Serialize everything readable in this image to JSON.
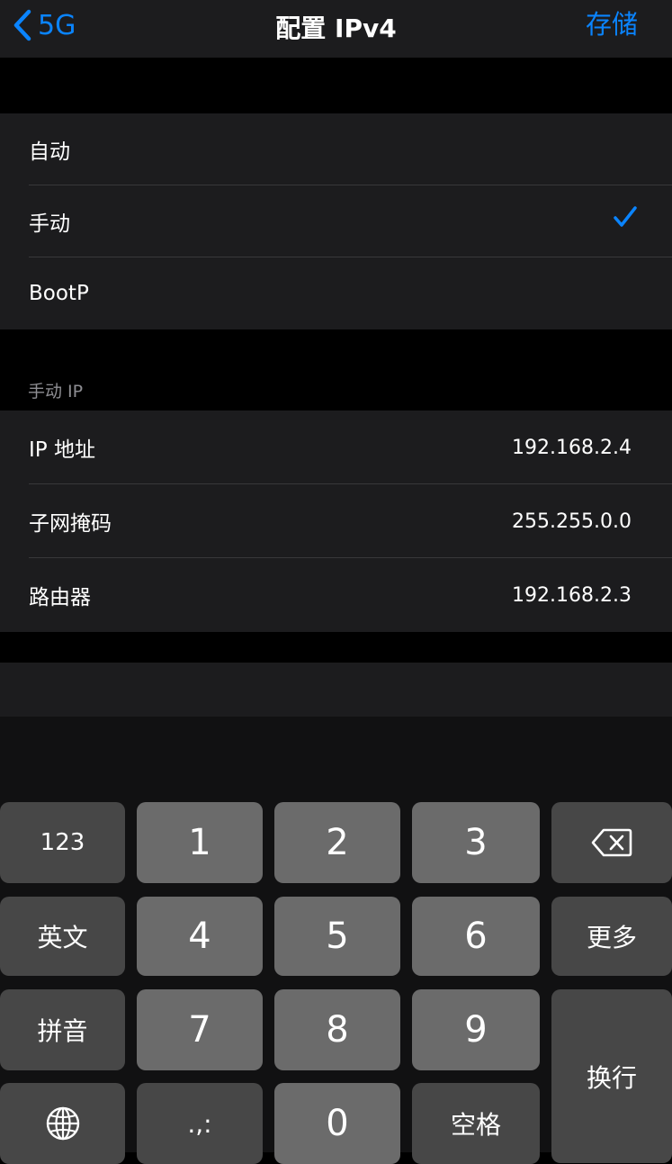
{
  "nav": {
    "back_label": "5G",
    "title": "配置 IPv4",
    "save_label": "存储"
  },
  "config_options": [
    {
      "label": "自动",
      "selected": false
    },
    {
      "label": "手动",
      "selected": true
    },
    {
      "label": "BootP",
      "selected": false
    }
  ],
  "manual_section": {
    "header": "手动 IP",
    "fields": [
      {
        "label": "IP 地址",
        "value": "192.168.2.4"
      },
      {
        "label": "子网掩码",
        "value": "255.255.0.0"
      },
      {
        "label": "路由器",
        "value": "192.168.2.3"
      }
    ]
  },
  "keyboard": {
    "numbers_mode": "123",
    "english": "英文",
    "pinyin": "拼音",
    "more": "更多",
    "return": "换行",
    "space": "空格",
    "punct": ".,:",
    "digits": [
      "1",
      "2",
      "3",
      "4",
      "5",
      "6",
      "7",
      "8",
      "9",
      "0"
    ],
    "icons": {
      "delete": "backspace-icon",
      "globe": "globe-icon"
    }
  },
  "colors": {
    "accent": "#0a84ff",
    "background": "#000000",
    "cell": "#1c1c1e",
    "secondary_text": "#8e8e93"
  }
}
